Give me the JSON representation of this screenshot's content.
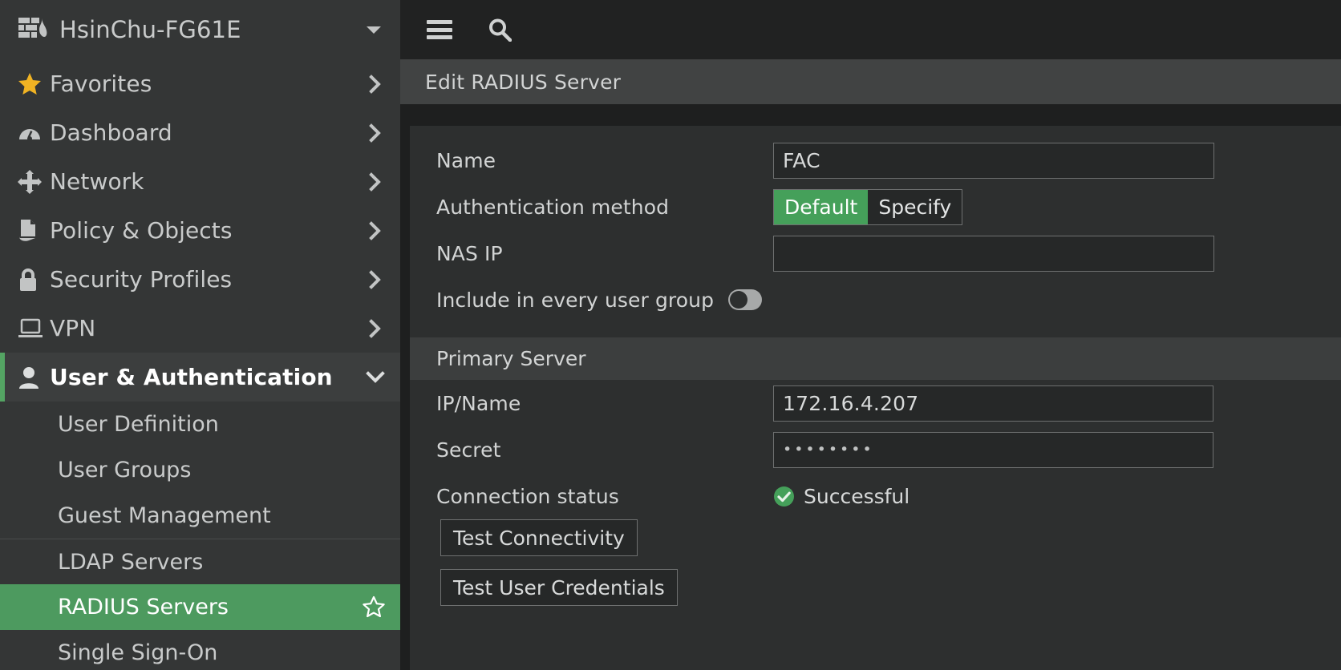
{
  "colors": {
    "accent_green": "#4d9a5f",
    "seg_green": "#45a05a",
    "status_green": "#45a05a",
    "star_yellow": "#f0b323",
    "sidebar_bg": "#343636",
    "panel_bg": "#2d2f2f"
  },
  "sidebar": {
    "device": {
      "name": "HsinChu-FG61E",
      "logo_icon": "firewall-icon",
      "caret_icon": "caret-down-icon"
    },
    "items": [
      {
        "label": "Favorites",
        "icon": "star-icon",
        "chevron": "chevron-right-icon",
        "state": "collapsed"
      },
      {
        "label": "Dashboard",
        "icon": "gauge-icon",
        "chevron": "chevron-right-icon",
        "state": "collapsed"
      },
      {
        "label": "Network",
        "icon": "network-move-icon",
        "chevron": "chevron-right-icon",
        "state": "collapsed"
      },
      {
        "label": "Policy & Objects",
        "icon": "policy-document-icon",
        "chevron": "chevron-right-icon",
        "state": "collapsed"
      },
      {
        "label": "Security Profiles",
        "icon": "lock-icon",
        "chevron": "chevron-right-icon",
        "state": "collapsed"
      },
      {
        "label": "VPN",
        "icon": "laptop-icon",
        "chevron": "chevron-right-icon",
        "state": "collapsed"
      },
      {
        "label": "User & Authentication",
        "icon": "user-icon",
        "chevron": "chevron-down-icon",
        "state": "expanded"
      }
    ],
    "sub_items": [
      {
        "label": "User Definition",
        "selected": false,
        "divider_above": false
      },
      {
        "label": "User Groups",
        "selected": false,
        "divider_above": false
      },
      {
        "label": "Guest Management",
        "selected": false,
        "divider_above": false
      },
      {
        "label": "LDAP Servers",
        "selected": false,
        "divider_above": true
      },
      {
        "label": "RADIUS Servers",
        "selected": true,
        "divider_above": false,
        "star_icon": "star-outline-icon"
      },
      {
        "label": "Single Sign-On",
        "selected": false,
        "divider_above": false
      }
    ]
  },
  "topbar": {
    "menu_icon": "hamburger-menu-icon",
    "search_icon": "search-icon"
  },
  "page": {
    "title": "Edit RADIUS Server"
  },
  "form": {
    "name": {
      "label": "Name",
      "value": "FAC",
      "placeholder": ""
    },
    "auth_method": {
      "label": "Authentication method",
      "options": [
        "Default",
        "Specify"
      ],
      "selected": "Default"
    },
    "nas_ip": {
      "label": "NAS IP",
      "value": "",
      "placeholder": ""
    },
    "include_group": {
      "label": "Include in every user group",
      "enabled": false
    }
  },
  "primary_server": {
    "section_title": "Primary Server",
    "ip_name": {
      "label": "IP/Name",
      "value": "172.16.4.207",
      "placeholder": ""
    },
    "secret": {
      "label": "Secret",
      "value": "••••••••",
      "placeholder": ""
    },
    "connection_status": {
      "label": "Connection status",
      "value": "Successful",
      "icon": "check-circle-icon"
    },
    "buttons": {
      "test_connectivity": "Test Connectivity",
      "test_user_credentials": "Test User Credentials"
    }
  }
}
